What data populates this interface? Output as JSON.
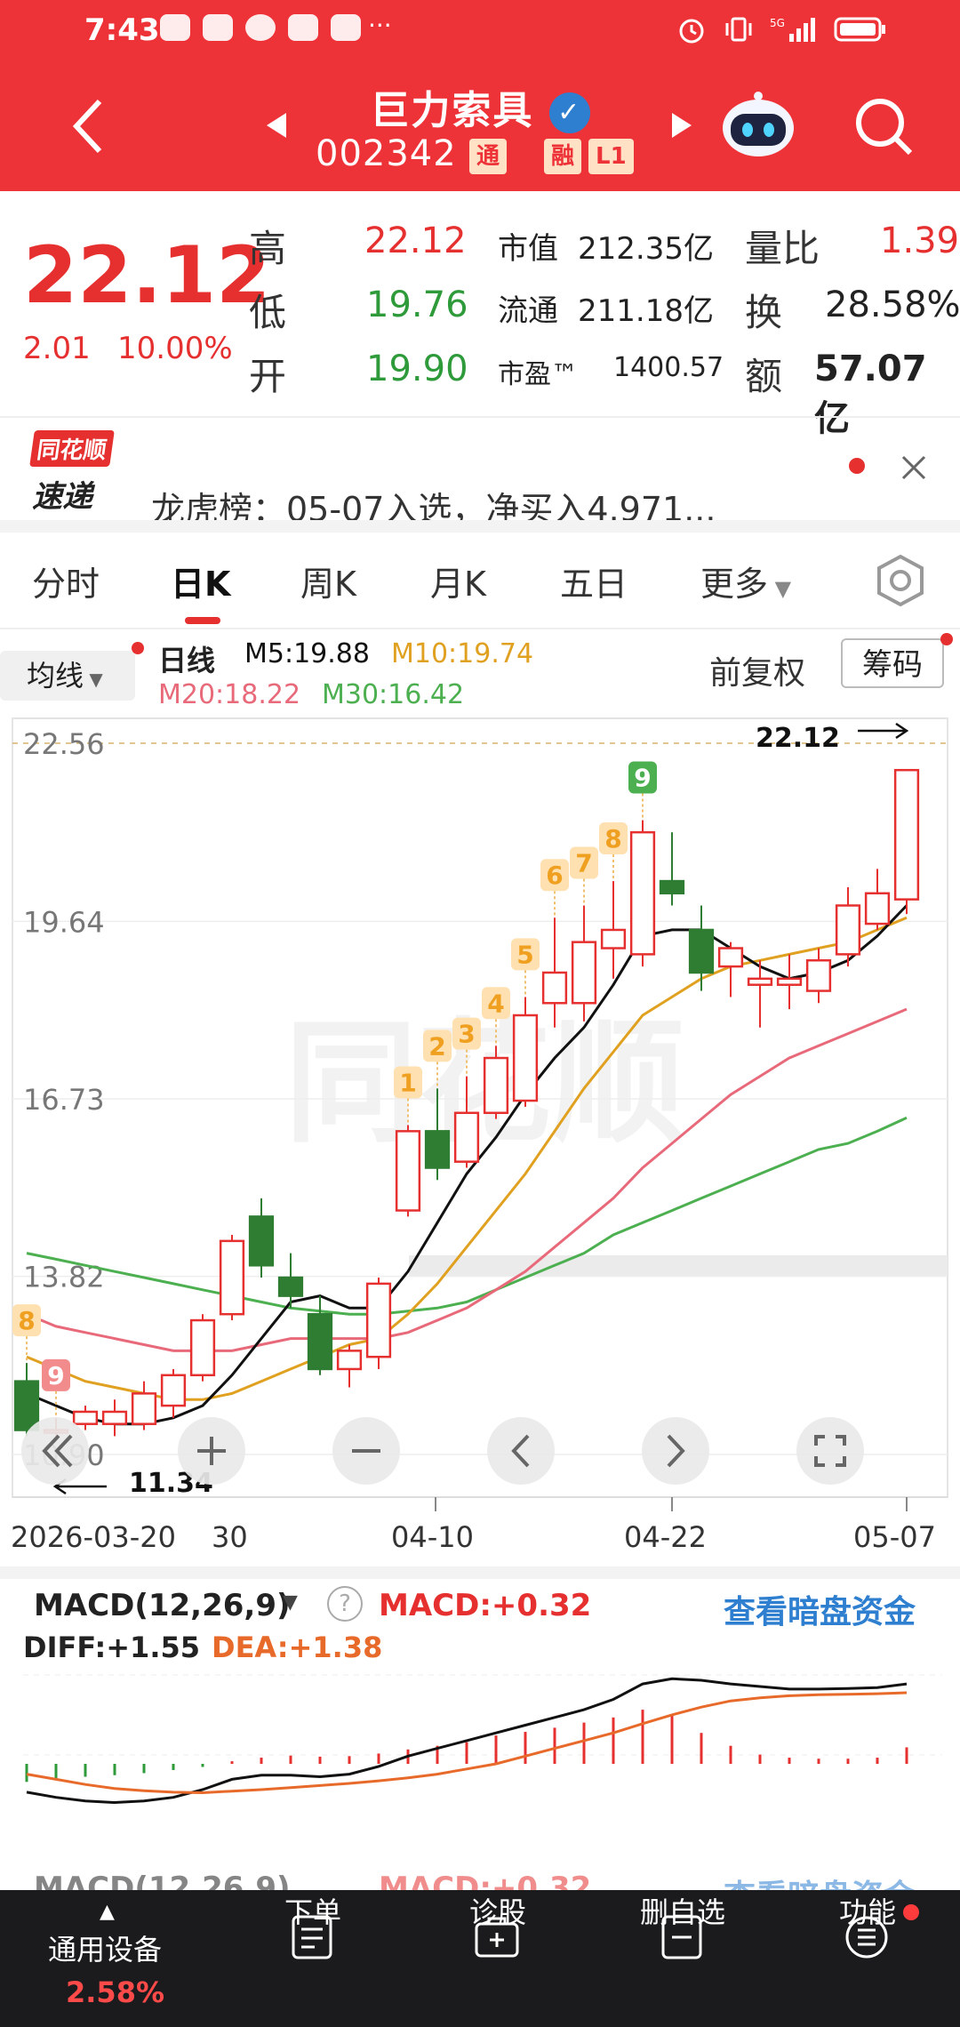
{
  "status": {
    "time": "7:43",
    "more": "···"
  },
  "header": {
    "name": "巨力索具",
    "code": "002342",
    "tags": [
      "通",
      "融",
      "L1"
    ]
  },
  "quote": {
    "price": "22.12",
    "change": "2.01",
    "change_pct": "10.00%",
    "high_label": "高",
    "high": "22.12",
    "low_label": "低",
    "low": "19.76",
    "open_label": "开",
    "open": "19.90",
    "mcap_label": "市值",
    "mcap": "212.35亿",
    "float_label": "流通",
    "float": "211.18亿",
    "pe_label": "市盈™",
    "pe": "1400.57",
    "vr_label": "量比",
    "vr": "1.39",
    "turn_label": "换",
    "turn": "28.58%",
    "amount_label": "额",
    "amount": "57.07亿"
  },
  "news": {
    "brand_top": "同花顺",
    "brand_bottom": "速递",
    "text": "龙虎榜：05-07入选，净买入4.971..."
  },
  "tabs": [
    "分时",
    "日K",
    "周K",
    "月K",
    "五日",
    "更多"
  ],
  "kline": {
    "ma_selector": "均线",
    "period_label": "日线",
    "ma5": "M5:19.88",
    "ma10": "M10:19.74",
    "ma20": "M20:18.22",
    "ma30": "M30:16.42",
    "adjust": "前复权",
    "chips": "筹码",
    "y_ticks": [
      "22.56",
      "19.64",
      "16.73",
      "13.82",
      "10.90"
    ],
    "x_ticks": [
      "2026-03-20",
      "30",
      "04-10",
      "04-22",
      "05-07"
    ],
    "high_marker": "22.12",
    "low_marker": "11.34",
    "watermark": "同花顺"
  },
  "macd": {
    "title": "MACD(12,26,9)",
    "macd_value": "MACD:+0.32",
    "diff": "DIFF:+1.55",
    "dea": "DEA:+1.38",
    "link": "查看暗盘资金"
  },
  "footer": {
    "items": [
      {
        "label": "通用设备",
        "sub": "2.58%"
      },
      {
        "label": "下单"
      },
      {
        "label": "诊股"
      },
      {
        "label": "删自选"
      },
      {
        "label": "功能"
      }
    ]
  },
  "colors": {
    "up": "#e5302f",
    "down": "#2e7d32",
    "header": "#ee3338",
    "ma5": "#111111",
    "ma10": "#e0a020",
    "ma20": "#e86a7a",
    "ma30": "#4caf50",
    "macd_link": "#2f7fd0"
  },
  "chart_data": {
    "type": "candlestick",
    "y_range": [
      10.9,
      22.56
    ],
    "candles": [
      {
        "o": 12.1,
        "c": 11.3,
        "h": 12.4,
        "l": 11.2
      },
      {
        "o": 11.3,
        "c": 11.3,
        "h": 11.5,
        "l": 11.2
      },
      {
        "o": 11.4,
        "c": 11.6,
        "h": 11.7,
        "l": 11.3
      },
      {
        "o": 11.4,
        "c": 11.6,
        "h": 11.8,
        "l": 11.2
      },
      {
        "o": 11.4,
        "c": 11.9,
        "h": 12.1,
        "l": 11.3
      },
      {
        "o": 11.7,
        "c": 12.2,
        "h": 12.3,
        "l": 11.5
      },
      {
        "o": 12.2,
        "c": 13.1,
        "h": 13.2,
        "l": 12.1
      },
      {
        "o": 13.2,
        "c": 14.4,
        "h": 14.5,
        "l": 13.1
      },
      {
        "o": 14.8,
        "c": 14.0,
        "h": 15.1,
        "l": 13.8
      },
      {
        "o": 13.8,
        "c": 13.5,
        "h": 14.2,
        "l": 13.3
      },
      {
        "o": 13.2,
        "c": 12.3,
        "h": 13.5,
        "l": 12.2
      },
      {
        "o": 12.3,
        "c": 12.6,
        "h": 12.7,
        "l": 12.0
      },
      {
        "o": 12.5,
        "c": 13.7,
        "h": 13.8,
        "l": 12.3
      },
      {
        "o": 14.9,
        "c": 16.2,
        "h": 16.3,
        "l": 14.8
      },
      {
        "o": 16.2,
        "c": 15.6,
        "h": 16.9,
        "l": 15.4
      },
      {
        "o": 15.7,
        "c": 16.5,
        "h": 17.1,
        "l": 15.6
      },
      {
        "o": 16.5,
        "c": 17.4,
        "h": 17.6,
        "l": 16.4
      },
      {
        "o": 16.7,
        "c": 18.1,
        "h": 18.4,
        "l": 16.6
      },
      {
        "o": 18.3,
        "c": 18.8,
        "h": 19.7,
        "l": 17.9
      },
      {
        "o": 18.3,
        "c": 19.3,
        "h": 19.9,
        "l": 18.0
      },
      {
        "o": 19.2,
        "c": 19.5,
        "h": 20.3,
        "l": 18.7
      },
      {
        "o": 19.1,
        "c": 21.1,
        "h": 21.3,
        "l": 18.9
      },
      {
        "o": 20.3,
        "c": 20.1,
        "h": 21.1,
        "l": 19.9
      },
      {
        "o": 19.5,
        "c": 18.8,
        "h": 19.9,
        "l": 18.5
      },
      {
        "o": 18.9,
        "c": 19.2,
        "h": 19.3,
        "l": 18.4
      },
      {
        "o": 18.6,
        "c": 18.7,
        "h": 19.0,
        "l": 17.9
      },
      {
        "o": 18.6,
        "c": 18.7,
        "h": 19.1,
        "l": 18.2
      },
      {
        "o": 18.5,
        "c": 19.0,
        "h": 19.2,
        "l": 18.3
      },
      {
        "o": 19.1,
        "c": 19.9,
        "h": 20.2,
        "l": 18.9
      },
      {
        "o": 19.6,
        "c": 20.1,
        "h": 20.5,
        "l": 19.5
      },
      {
        "o": 20.0,
        "c": 22.12,
        "h": 22.12,
        "l": 19.76
      }
    ],
    "ma5": [
      11.9,
      11.7,
      11.5,
      11.4,
      11.4,
      11.5,
      11.7,
      12.2,
      12.8,
      13.4,
      13.5,
      13.3,
      13.3,
      13.9,
      14.7,
      15.5,
      16.1,
      16.8,
      17.4,
      17.9,
      18.6,
      19.4,
      19.5,
      19.5,
      19.2,
      18.9,
      18.7,
      18.8,
      19.0,
      19.4,
      19.9
    ],
    "ma10": [
      12.5,
      12.3,
      12.1,
      12.0,
      11.9,
      11.8,
      11.8,
      11.9,
      12.1,
      12.3,
      12.5,
      12.7,
      12.8,
      13.2,
      13.7,
      14.3,
      14.9,
      15.5,
      16.2,
      16.9,
      17.5,
      18.1,
      18.4,
      18.7,
      18.9,
      19.0,
      19.1,
      19.2,
      19.3,
      19.5,
      19.7
    ],
    "ma20": [
      13.2,
      13.0,
      12.9,
      12.8,
      12.7,
      12.6,
      12.6,
      12.6,
      12.7,
      12.8,
      12.8,
      12.8,
      12.8,
      12.9,
      13.1,
      13.3,
      13.6,
      13.9,
      14.3,
      14.7,
      15.1,
      15.6,
      16.0,
      16.4,
      16.8,
      17.1,
      17.4,
      17.6,
      17.8,
      18.0,
      18.2
    ],
    "ma30": [
      14.2,
      14.1,
      14.0,
      13.9,
      13.8,
      13.7,
      13.6,
      13.5,
      13.4,
      13.3,
      13.25,
      13.2,
      13.2,
      13.25,
      13.3,
      13.4,
      13.6,
      13.8,
      14.0,
      14.2,
      14.5,
      14.7,
      14.9,
      15.1,
      15.3,
      15.5,
      15.7,
      15.9,
      16.0,
      16.2,
      16.42
    ],
    "markers": [
      {
        "i": 0,
        "label": "8",
        "pos": "above"
      },
      {
        "i": 1,
        "label": "9",
        "pos": "above"
      },
      {
        "i": 13,
        "label": "1",
        "pos": "above"
      },
      {
        "i": 14,
        "label": "2",
        "pos": "above"
      },
      {
        "i": 15,
        "label": "3",
        "pos": "above"
      },
      {
        "i": 16,
        "label": "4",
        "pos": "above"
      },
      {
        "i": 17,
        "label": "5",
        "pos": "above"
      },
      {
        "i": 18,
        "label": "6",
        "pos": "above"
      },
      {
        "i": 19,
        "label": "7",
        "pos": "above"
      },
      {
        "i": 20,
        "label": "8",
        "pos": "above"
      },
      {
        "i": 21,
        "label": "9",
        "pos": "above"
      }
    ],
    "macd_hist": [
      -0.35,
      -0.3,
      -0.25,
      -0.22,
      -0.18,
      -0.12,
      -0.06,
      0.05,
      0.12,
      0.16,
      0.14,
      0.15,
      0.2,
      0.28,
      0.35,
      0.42,
      0.55,
      0.62,
      0.7,
      0.8,
      0.9,
      1.05,
      0.95,
      0.6,
      0.35,
      0.18,
      0.12,
      0.1,
      0.1,
      0.12,
      0.32
    ],
    "diff": [
      -0.55,
      -0.65,
      -0.72,
      -0.75,
      -0.72,
      -0.65,
      -0.5,
      -0.3,
      -0.22,
      -0.22,
      -0.25,
      -0.2,
      -0.05,
      0.15,
      0.3,
      0.45,
      0.6,
      0.75,
      0.9,
      1.05,
      1.25,
      1.55,
      1.65,
      1.62,
      1.55,
      1.5,
      1.45,
      1.45,
      1.46,
      1.48,
      1.55
    ],
    "dea": [
      -0.2,
      -0.3,
      -0.4,
      -0.48,
      -0.52,
      -0.55,
      -0.56,
      -0.53,
      -0.5,
      -0.46,
      -0.42,
      -0.38,
      -0.33,
      -0.27,
      -0.2,
      -0.1,
      0.0,
      0.15,
      0.3,
      0.45,
      0.6,
      0.78,
      0.95,
      1.1,
      1.22,
      1.28,
      1.32,
      1.34,
      1.35,
      1.36,
      1.38
    ]
  }
}
